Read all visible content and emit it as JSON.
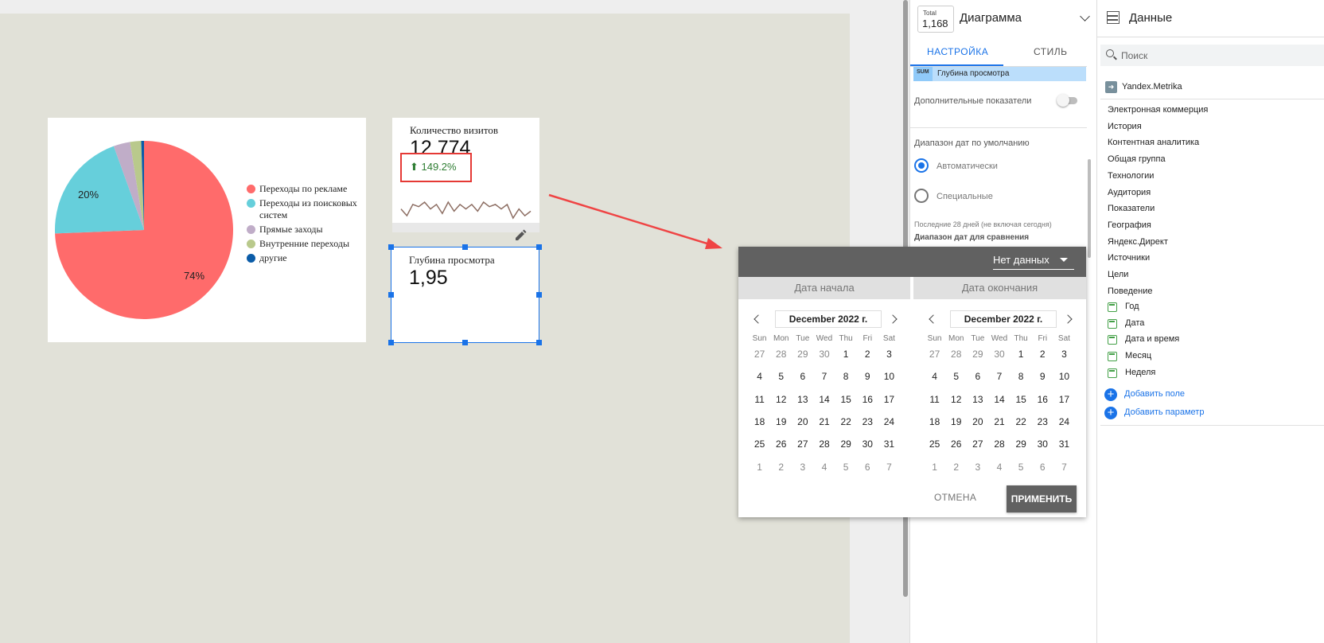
{
  "canvas": {
    "pie_chart": {
      "chart_data": {
        "type": "pie",
        "slices": [
          {
            "label": "Переходы по рекламе",
            "value": 74,
            "color": "#ff6b6b"
          },
          {
            "label": "Переходы из поисковых систем",
            "value": 20,
            "color": "#66cfdb"
          },
          {
            "label": "Прямые заходы",
            "value": 3,
            "color": "#c0adc8"
          },
          {
            "label": "Внутренние переходы",
            "value": 2,
            "color": "#b9c98c"
          },
          {
            "label": "другие",
            "value": 0.5,
            "color": "#0b5ca8"
          }
        ],
        "data_labels": [
          "74%",
          "20%"
        ],
        "legend_placement": "right"
      },
      "legend": [
        {
          "text": "Переходы по рекламе",
          "color": "#ff6b6b"
        },
        {
          "text": "Переходы из поисковых систем",
          "color": "#66cfdb"
        },
        {
          "text": "Прямые заходы",
          "color": "#c0adc8"
        },
        {
          "text": "Внутренние переходы",
          "color": "#b9c98c"
        },
        {
          "text": "другие",
          "color": "#0b5ca8"
        }
      ],
      "label_74": "74%",
      "label_20": "20%"
    },
    "kpi_visits": {
      "title": "Количество визитов",
      "value": "12 774",
      "delta": "⬆ 149.2%",
      "sparkline": [
        6,
        3,
        8,
        7,
        9,
        6,
        8,
        4,
        9,
        5,
        8,
        6,
        8,
        5,
        9,
        7,
        8,
        6,
        8,
        2,
        6,
        3,
        5
      ]
    },
    "kpi_depth": {
      "title": "Глубина просмотра",
      "value": "1,95"
    }
  },
  "date_picker": {
    "header_value": "Нет данных",
    "start_tab": "Дата начала",
    "end_tab": "Дата окончания",
    "month_label": "December 2022 г.",
    "weekdays": [
      "Sun",
      "Mon",
      "Tue",
      "Wed",
      "Thu",
      "Fri",
      "Sat"
    ],
    "weeks": [
      [
        {
          "d": "27",
          "out": true
        },
        {
          "d": "28",
          "out": true
        },
        {
          "d": "29",
          "out": true
        },
        {
          "d": "30",
          "out": true
        },
        {
          "d": "1"
        },
        {
          "d": "2"
        },
        {
          "d": "3"
        }
      ],
      [
        {
          "d": "4"
        },
        {
          "d": "5"
        },
        {
          "d": "6"
        },
        {
          "d": "7"
        },
        {
          "d": "8"
        },
        {
          "d": "9"
        },
        {
          "d": "10"
        }
      ],
      [
        {
          "d": "11"
        },
        {
          "d": "12"
        },
        {
          "d": "13"
        },
        {
          "d": "14"
        },
        {
          "d": "15"
        },
        {
          "d": "16"
        },
        {
          "d": "17"
        }
      ],
      [
        {
          "d": "18"
        },
        {
          "d": "19"
        },
        {
          "d": "20"
        },
        {
          "d": "21"
        },
        {
          "d": "22"
        },
        {
          "d": "23"
        },
        {
          "d": "24"
        }
      ],
      [
        {
          "d": "25"
        },
        {
          "d": "26"
        },
        {
          "d": "27"
        },
        {
          "d": "28"
        },
        {
          "d": "29"
        },
        {
          "d": "30"
        },
        {
          "d": "31"
        }
      ],
      [
        {
          "d": "1",
          "out": true
        },
        {
          "d": "2",
          "out": true
        },
        {
          "d": "3",
          "out": true
        },
        {
          "d": "4",
          "out": true
        },
        {
          "d": "5",
          "out": true
        },
        {
          "d": "6",
          "out": true
        },
        {
          "d": "7",
          "out": true
        }
      ]
    ],
    "cancel_label": "ОТМЕНА",
    "apply_label": "ПРИМЕНИТЬ"
  },
  "properties_panel": {
    "total_label": "Total",
    "total_value": "1,168",
    "chart_type": "Диаграмма",
    "tab_setup": "НАСТРОЙКА",
    "tab_style": "СТИЛЬ",
    "metric_agg": "SUM",
    "metric_name": "Глубина просмотра",
    "extra_metrics_label": "Дополнительные показатели",
    "date_range_heading": "Диапазон дат по умолчанию",
    "radio_auto": "Автоматически",
    "radio_custom": "Специальные",
    "last_28_days": "Последние 28 дней (не включая сегодня)",
    "compare_heading": "Диапазон дат для сравнения"
  },
  "data_panel": {
    "title": "Данные",
    "search_placeholder": "Поиск",
    "source_name": "Yandex.Metrika",
    "groups": [
      "Электронная коммерция",
      "История",
      "Контентная аналитика",
      "Общая группа",
      "Технологии",
      "Аудитория",
      "Показатели",
      "География",
      "Яндекс.Директ",
      "Источники",
      "Цели",
      "Поведение"
    ],
    "dimensions": [
      "Год",
      "Дата",
      "Дата и время",
      "Месяц",
      "Неделя"
    ],
    "add_field": "Добавить поле",
    "add_param": "Добавить параметр"
  },
  "colors": {
    "accent": "#1a73e8",
    "highlight_red": "#e53935",
    "delta_green": "#2e7d32",
    "canvas_bg": "#e1e1d8"
  }
}
